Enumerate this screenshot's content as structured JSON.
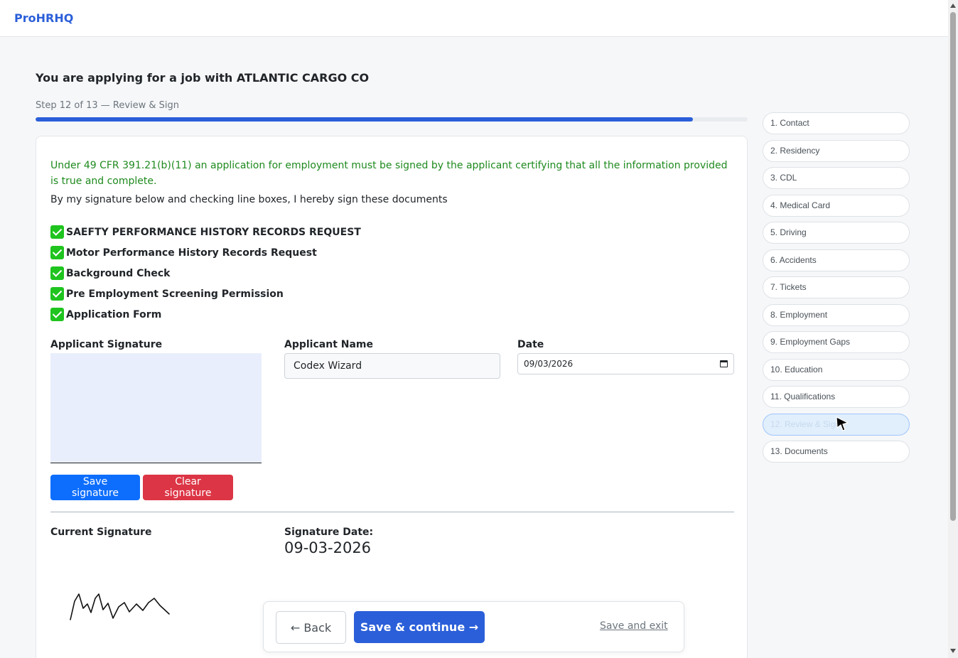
{
  "brand": "ProHRHQ",
  "page": {
    "heading": "You are applying for a job with ATLANTIC CARGO CO",
    "step_label": "Step 12 of 13 — Review & Sign",
    "progress_percent": 92.3
  },
  "form": {
    "notice": "Under 49 CFR 391.21(b)(11) an application for employment must be signed by the applicant certifying that all the information provided is true and complete.",
    "intro": "By my signature below and checking line boxes, I hereby sign these documents",
    "documents": [
      {
        "label": "SAEFTY PERFORMANCE HISTORY RECORDS REQUEST",
        "checked": true
      },
      {
        "label": "Motor Performance History Records Request",
        "checked": true
      },
      {
        "label": "Background Check",
        "checked": true
      },
      {
        "label": "Pre Employment Screening Permission",
        "checked": true
      },
      {
        "label": "Application Form",
        "checked": true
      }
    ],
    "signature_label": "Applicant Signature",
    "name_label": "Applicant Name",
    "name_value": "Codex Wizard",
    "date_label": "Date",
    "date_value": "09/03/2026",
    "save_signature_label": "Save signature",
    "clear_signature_label": "Clear signature",
    "current_signature_label": "Current Signature",
    "signature_date_label": "Signature Date:",
    "signature_date_value": "09-03-2026"
  },
  "sidebar": {
    "steps": [
      {
        "label": "1. Contact",
        "active": false
      },
      {
        "label": "2. Residency",
        "active": false
      },
      {
        "label": "3. CDL",
        "active": false
      },
      {
        "label": "4. Medical Card",
        "active": false
      },
      {
        "label": "5. Driving",
        "active": false
      },
      {
        "label": "6. Accidents",
        "active": false
      },
      {
        "label": "7. Tickets",
        "active": false
      },
      {
        "label": "8. Employment",
        "active": false
      },
      {
        "label": "9. Employment Gaps",
        "active": false
      },
      {
        "label": "10. Education",
        "active": false
      },
      {
        "label": "11. Qualifications",
        "active": false
      },
      {
        "label": "12. Review & Sign",
        "active": true
      },
      {
        "label": "13. Documents",
        "active": false
      }
    ]
  },
  "footer": {
    "back_label": "← Back",
    "continue_label": "Save & continue →",
    "exit_label": "Save and exit"
  },
  "colors": {
    "brand": "#2b5fd9",
    "notice_green": "#1e8a1e",
    "check_green": "#1fc41f",
    "primary_blue": "#0d6efd",
    "danger_red": "#dc3545",
    "signature_pad": "#e8eefc"
  }
}
